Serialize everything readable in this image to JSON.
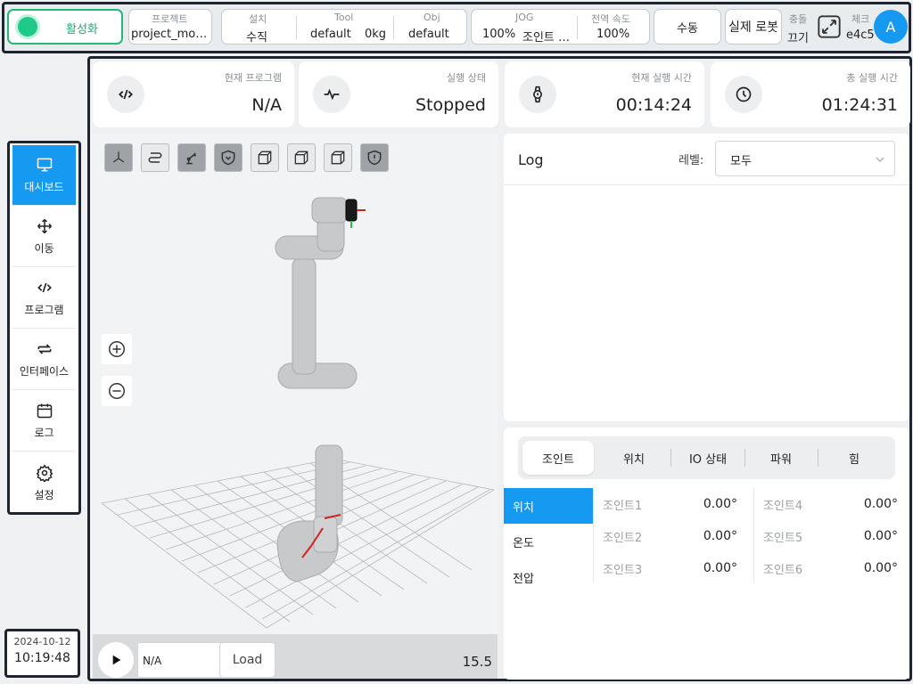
{
  "topbar": {
    "activate_label": "활성화",
    "project": {
      "label": "프로젝트",
      "value": "project_mo…"
    },
    "install": {
      "label": "설치",
      "value": "수직"
    },
    "tool": {
      "label": "Tool",
      "name": "default",
      "weight": "0kg"
    },
    "obj": {
      "label": "Obj",
      "value": "default"
    },
    "jog": {
      "label": "JOG",
      "percent": "100%",
      "mode": "조인트 …"
    },
    "global_speed": {
      "label": "전역 속도",
      "value": "100%"
    },
    "manual_label": "수동",
    "real_robot_label": "실제 로봇",
    "collision": {
      "label": "충돌",
      "value": "끄기"
    },
    "check": {
      "label": "체크",
      "value": "e4c5"
    },
    "avatar_letter": "A"
  },
  "nav": {
    "items": [
      {
        "label": "대시보드",
        "icon": "monitor-icon",
        "active": true
      },
      {
        "label": "이동",
        "icon": "move-icon"
      },
      {
        "label": "프로그램",
        "icon": "code-icon"
      },
      {
        "label": "인터페이스",
        "icon": "swap-icon"
      },
      {
        "label": "로그",
        "icon": "calendar-icon"
      },
      {
        "label": "설정",
        "icon": "gear-icon"
      }
    ]
  },
  "datetime": {
    "date": "2024-10-12",
    "time": "10:19:48"
  },
  "cards": {
    "current_program": {
      "label": "현재 프로그램",
      "value": "N/A"
    },
    "run_state": {
      "label": "실행 상태",
      "value": "Stopped"
    },
    "current_run_time": {
      "label": "현재 실행 시간",
      "value": "00:14:24"
    },
    "total_run_time": {
      "label": "총 실행 시간",
      "value": "01:24:31"
    }
  },
  "viewport": {
    "program_name": "N/A",
    "load_label": "Load",
    "fps": "15.5"
  },
  "log": {
    "title": "Log",
    "level_label": "레벨:",
    "level_value": "모두"
  },
  "joint_panel": {
    "tabs": [
      "조인트",
      "위치",
      "IO 상태",
      "파워",
      "힘"
    ],
    "side_tabs": [
      "위치",
      "온도",
      "전압"
    ],
    "joints": [
      {
        "name": "조인트1",
        "value": "0.00°"
      },
      {
        "name": "조인트2",
        "value": "0.00°"
      },
      {
        "name": "조인트3",
        "value": "0.00°"
      },
      {
        "name": "조인트4",
        "value": "0.00°"
      },
      {
        "name": "조인트5",
        "value": "0.00°"
      },
      {
        "name": "조인트6",
        "value": "0.00°"
      }
    ]
  },
  "colors": {
    "accent": "#1699f0",
    "active_green": "#1ec98a",
    "frame": "#1e2530"
  }
}
